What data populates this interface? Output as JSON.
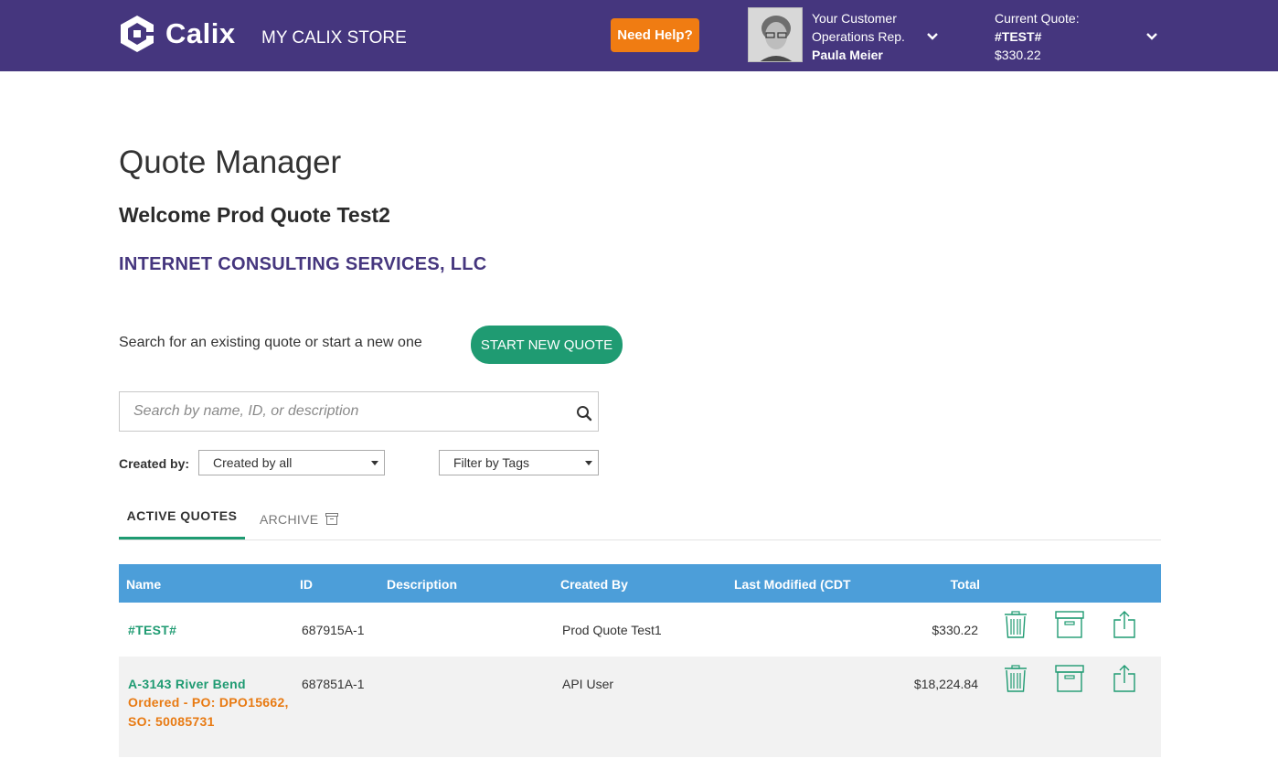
{
  "header": {
    "logo_text": "Calix",
    "store_title": "MY CALIX STORE",
    "help_button": "Need Help?",
    "rep_line1": "Your Customer",
    "rep_line2": "Operations Rep.",
    "rep_name": "Paula Meier",
    "quote_label": "Current Quote:",
    "quote_name": "#TEST#",
    "quote_total": "$330.22"
  },
  "main": {
    "title": "Quote Manager",
    "welcome": "Welcome Prod Quote Test2",
    "company": "INTERNET CONSULTING SERVICES, LLC",
    "search_prompt": "Search for an existing quote or start a new one",
    "start_button": "START NEW QUOTE",
    "search_placeholder": "Search by name, ID, or description",
    "created_by_label": "Created by:",
    "created_by_value": "Created by all",
    "tags_value": "Filter by Tags"
  },
  "tabs": {
    "active": "ACTIVE QUOTES",
    "archive": "ARCHIVE"
  },
  "table": {
    "headers": {
      "name": "Name",
      "id": "ID",
      "description": "Description",
      "created_by": "Created By",
      "last_modified": "Last Modified (CDT",
      "total": "Total"
    },
    "rows": [
      {
        "name": "#TEST#",
        "status_line1": "",
        "status_line2": "",
        "status_line3": "",
        "id": "687915A-1",
        "description": "",
        "created_by": "Prod Quote Test1",
        "last_modified": "",
        "total": "$330.22"
      },
      {
        "name": "A-3143 River Bend",
        "status_line1": "Ordered - PO: DPO15662,",
        "status_line2": "SO: 50085731",
        "status_line3": "",
        "id": "687851A-1",
        "description": "",
        "created_by": "API User",
        "last_modified": "",
        "total": "$18,224.84"
      }
    ]
  },
  "colors": {
    "header_bg": "#45367e",
    "accent_green": "#1f9b72",
    "help_orange": "#f07c12",
    "table_header_blue": "#4c9ed9",
    "status_orange": "#e87a12",
    "company_purple": "#45367e"
  },
  "icons": {
    "search": "search-icon",
    "archive": "archive-box-icon",
    "delete": "trash-icon",
    "share": "share-icon",
    "dropdown": "chevron-down-icon"
  }
}
